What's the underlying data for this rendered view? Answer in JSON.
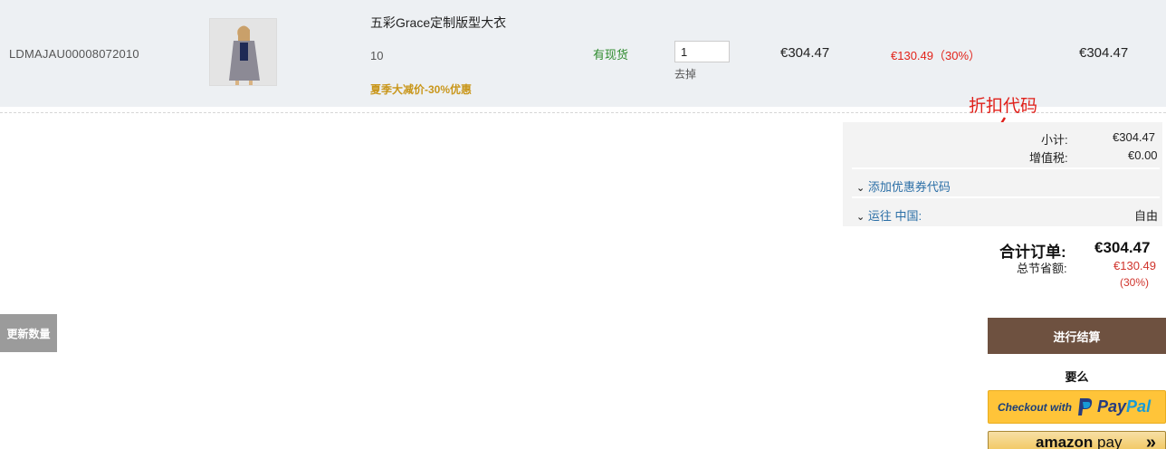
{
  "product": {
    "sku": "LDMAJAU00008072010",
    "image_alt": "model wearing gray coat",
    "name": "五彩Grace定制版型大衣",
    "size": "10",
    "promo": "夏季大减价-30%优惠",
    "stock": "有现货",
    "quantity": "1",
    "remove_label": "去掉",
    "unit_price": "€304.47",
    "discount": "€130.49（30%）",
    "line_total": "€304.47"
  },
  "annotation": {
    "text": "折扣代码",
    "color": "#e0201a"
  },
  "summary": {
    "subtotal_label": "小计:",
    "subtotal_value": "€304.47",
    "vat_label": "增值税:",
    "vat_value": "€0.00",
    "coupon_label": "添加优惠券代码",
    "shipping_label": "运往  中国:",
    "shipping_value": "自由"
  },
  "order_total": {
    "label": "合计订单:",
    "value": "€304.47",
    "savings_label": "总节省额:",
    "savings_value": "€130.49",
    "savings_pct": "(30%)"
  },
  "buttons": {
    "update_label": "更新数量",
    "checkout_label": "进行结算",
    "or_label": "要么",
    "paypal_with": "Checkout with",
    "paypal_logo_a": "Pay",
    "paypal_logo_b": "Pal",
    "amazon_logo": "amazon",
    "amazon_pay": "pay"
  },
  "icons": {
    "chevron": "chevron-down-icon",
    "paypal": "paypal-logo-icon",
    "amazon_chevron": "double-chevron-right-icon"
  },
  "colors": {
    "row_background": "#edf0f3",
    "checkout_button": "#6e5140",
    "paypal_button": "#ffc439",
    "discount_red": "#e2231a",
    "stock_green": "#2e8b2e",
    "promo_gold": "#c9961a",
    "link_blue": "#2a6ea6"
  }
}
